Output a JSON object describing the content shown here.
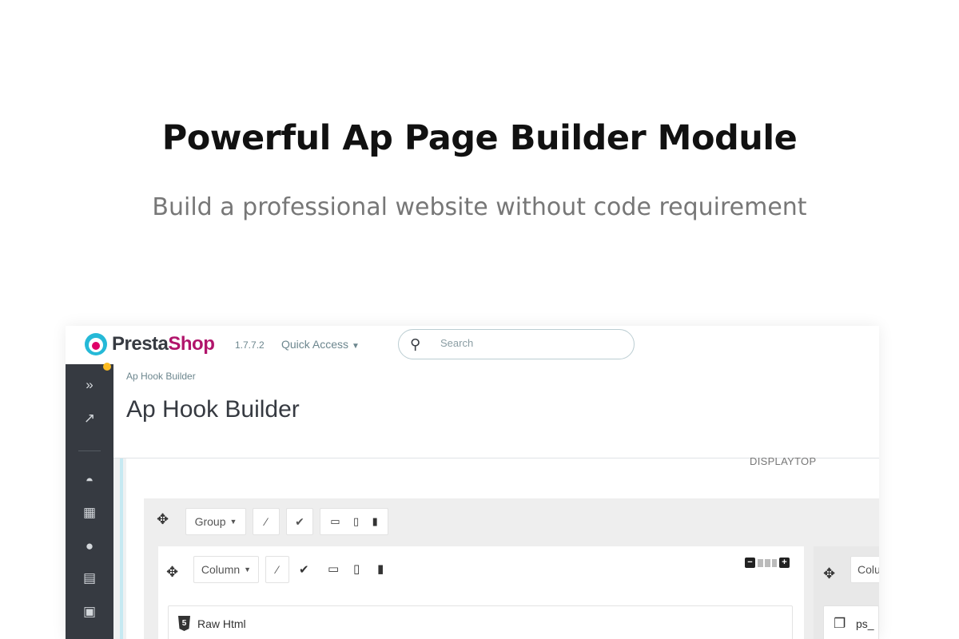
{
  "hero": {
    "title": "Powerful Ap Page Builder Module",
    "subtitle": "Build a professional website without code requirement"
  },
  "topbar": {
    "logo_part1": "Presta",
    "logo_part2": "Shop",
    "version": "1.7.7.2",
    "quick_access": "Quick Access",
    "search_placeholder": "Search"
  },
  "page": {
    "breadcrumb": "Ap Hook Builder",
    "title": "Ap Hook Builder",
    "hook_name": "DISPLAYTOP"
  },
  "builder": {
    "group_label": "Group",
    "column_label": "Column",
    "column2_label": "Colu",
    "widget_label": "Raw Html",
    "widget2_label": "ps_"
  },
  "colors": {
    "sidebar": "#363a41",
    "accent": "#25b9d7",
    "brand_pink": "#b1146b",
    "notification": "#fbbb22"
  },
  "icons": {
    "sidebar": [
      "expand-icon",
      "stats-icon",
      "orders-icon",
      "catalog-icon",
      "customers-icon",
      "messages-icon",
      "reports-icon"
    ]
  }
}
